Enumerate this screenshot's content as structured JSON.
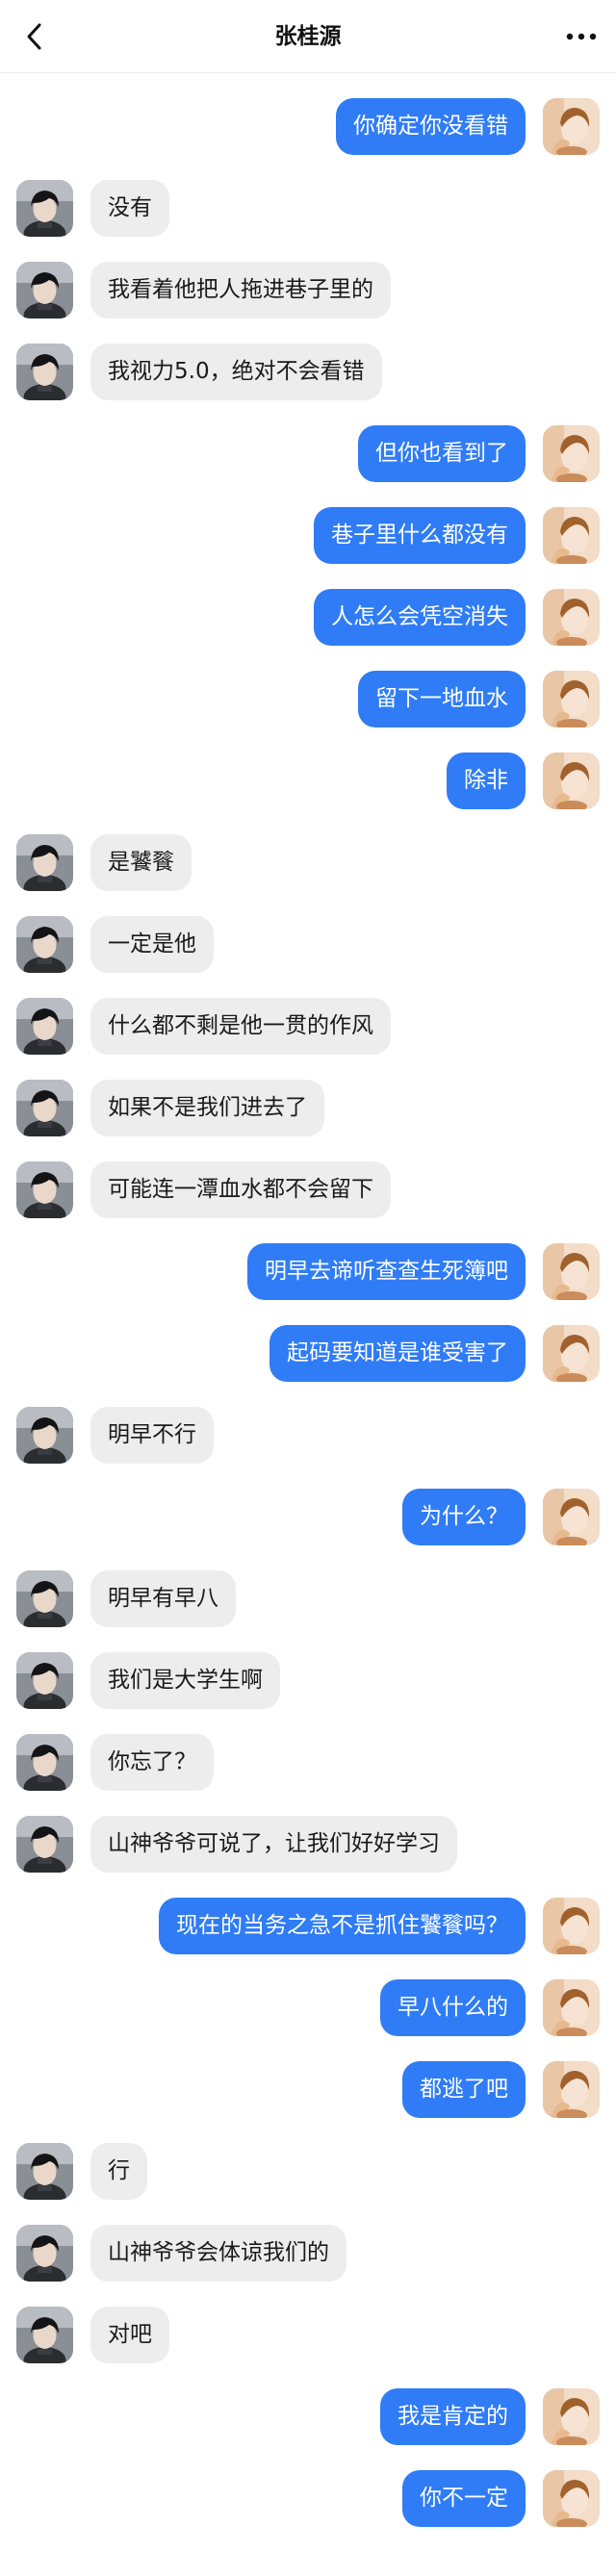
{
  "header": {
    "title": "张桂源",
    "back_icon": "chevron-left-icon",
    "more_icon": "more-horizontal-icon"
  },
  "colors": {
    "outgoing_bubble": "#2f7cf6",
    "incoming_bubble": "#ededed"
  },
  "messages": [
    {
      "side": "right",
      "text": "你确定你没看错"
    },
    {
      "side": "left",
      "text": "没有"
    },
    {
      "side": "left",
      "text": "我看着他把人拖进巷子里的"
    },
    {
      "side": "left",
      "text": "我视力5.0，绝对不会看错"
    },
    {
      "side": "right",
      "text": "但你也看到了"
    },
    {
      "side": "right",
      "text": "巷子里什么都没有"
    },
    {
      "side": "right",
      "text": "人怎么会凭空消失"
    },
    {
      "side": "right",
      "text": "留下一地血水"
    },
    {
      "side": "right",
      "text": "除非"
    },
    {
      "side": "left",
      "text": "是饕餮"
    },
    {
      "side": "left",
      "text": "一定是他"
    },
    {
      "side": "left",
      "text": "什么都不剩是他一贯的作风"
    },
    {
      "side": "left",
      "text": "如果不是我们进去了"
    },
    {
      "side": "left",
      "text": "可能连一潭血水都不会留下"
    },
    {
      "side": "right",
      "text": "明早去谛听查查生死簿吧"
    },
    {
      "side": "right",
      "text": "起码要知道是谁受害了"
    },
    {
      "side": "left",
      "text": "明早不行"
    },
    {
      "side": "right",
      "text": "为什么？"
    },
    {
      "side": "left",
      "text": "明早有早八"
    },
    {
      "side": "left",
      "text": "我们是大学生啊"
    },
    {
      "side": "left",
      "text": "你忘了？"
    },
    {
      "side": "left",
      "text": "山神爷爷可说了，让我们好好学习"
    },
    {
      "side": "right",
      "text": "现在的当务之急不是抓住饕餮吗？"
    },
    {
      "side": "right",
      "text": "早八什么的"
    },
    {
      "side": "right",
      "text": "都逃了吧"
    },
    {
      "side": "left",
      "text": "行"
    },
    {
      "side": "left",
      "text": "山神爷爷会体谅我们的"
    },
    {
      "side": "left",
      "text": "对吧"
    },
    {
      "side": "right",
      "text": "我是肯定的"
    },
    {
      "side": "right",
      "text": "你不一定"
    }
  ]
}
